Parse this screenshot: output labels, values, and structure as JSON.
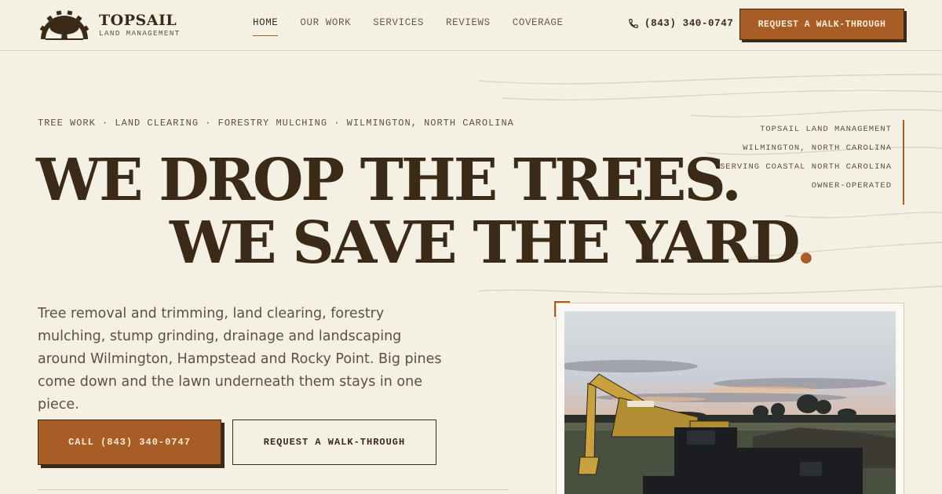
{
  "brand": {
    "name": "TOPSAIL",
    "subtitle": "LAND MANAGEMENT",
    "logo_icon": "gear-tree-icon"
  },
  "nav": {
    "items": [
      {
        "label": "HOME",
        "active": true
      },
      {
        "label": "OUR WORK",
        "active": false
      },
      {
        "label": "SERVICES",
        "active": false
      },
      {
        "label": "REVIEWS",
        "active": false
      },
      {
        "label": "COVERAGE",
        "active": false
      }
    ]
  },
  "header": {
    "phone": "(843) 340-0747",
    "phone_icon": "phone-icon",
    "cta_label": "REQUEST A WALK-THROUGH"
  },
  "hero": {
    "eyebrow": "TREE WORK · LAND CLEARING · FORESTRY MULCHING · WILMINGTON, NORTH CAROLINA",
    "headline_line1": "WE DROP THE TREES.",
    "headline_line2": "WE SAVE THE YARD",
    "headline_dot": ".",
    "lead": "Tree removal and trimming, land clearing, forestry mulching, stump grinding, drainage and landscaping around Wilmington, Hampstead and Rocky Point. Big pines come down and the lawn underneath them stays in one piece.",
    "call_button": "CALL (843) 340-0747",
    "walk_button": "REQUEST A WALK-THROUGH"
  },
  "side_meta": [
    "TOPSAIL LAND MANAGEMENT",
    "WILMINGTON, NORTH CAROLINA",
    "SERVING COASTAL NORTH CAROLINA",
    "OWNER-OPERATED"
  ],
  "colors": {
    "background": "#f5f0e4",
    "ink": "#3a2a17",
    "accent": "#a85d24",
    "muted": "#5f4f3c"
  }
}
